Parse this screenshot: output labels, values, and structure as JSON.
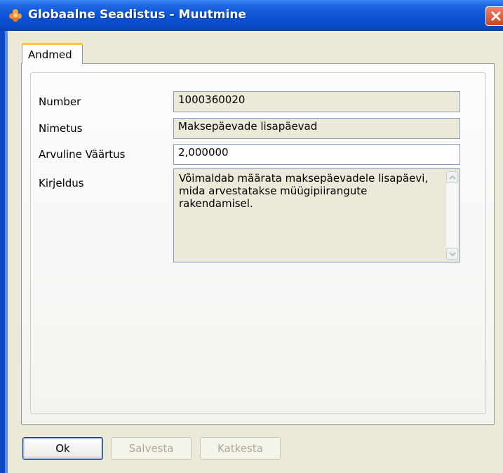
{
  "window": {
    "title": "Globaalne Seadistus - Muutmine",
    "colors": {
      "titlebar": "#0a52d6",
      "face": "#ece9d8",
      "tab_accent": "#ffc83c",
      "close": "#d2421e"
    }
  },
  "tabs": [
    {
      "label": "Andmed",
      "selected": true
    }
  ],
  "form": {
    "number": {
      "label": "Number",
      "value": "1000360020"
    },
    "name": {
      "label": "Nimetus",
      "value": "Maksepäevade lisapäevad"
    },
    "numeric_value": {
      "label": "Arvuline Väärtus",
      "value": "2,000000"
    },
    "description": {
      "label": "Kirjeldus",
      "line1": "Võimaldab määrata maksepäevadele lisapäevi,",
      "line2": "mida arvestatakse müügipiirangute rakendamisel."
    }
  },
  "buttons": {
    "ok": "Ok",
    "save": "Salvesta",
    "cancel": "Katkesta"
  },
  "icons": [
    "app-icon",
    "close-icon",
    "scroll-up-icon",
    "scroll-down-icon"
  ]
}
